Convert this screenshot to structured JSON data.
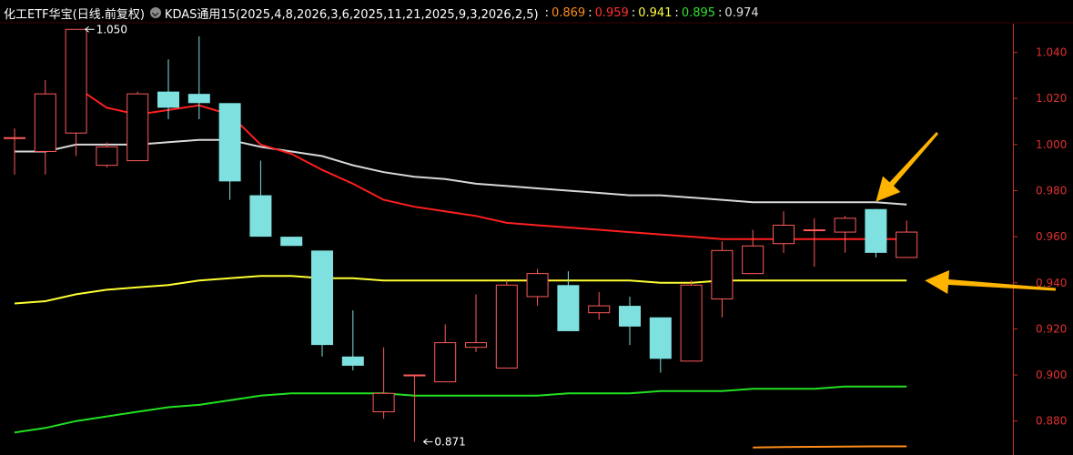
{
  "header": {
    "title": "化工ETF华宝(日线.前复权)",
    "indicator": "KDAS通用15(2025,4,8,2026,3,6,2025,11,21,2025,9,3,2026,2,5)",
    "values": [
      {
        "text": "0.869",
        "color": "#ff8c1a"
      },
      {
        "text": "0.959",
        "color": "#ff3030"
      },
      {
        "text": "0.941",
        "color": "#ffff40"
      },
      {
        "text": "0.895",
        "color": "#30e030"
      },
      {
        "text": "0.974",
        "color": "#e0e0e0"
      }
    ]
  },
  "chart_data": {
    "type": "candlestick",
    "y_ticks": [
      "0.880",
      "0.900",
      "0.920",
      "0.940",
      "0.960",
      "0.980",
      "1.000",
      "1.020",
      "1.040"
    ],
    "ylim": [
      0.8692,
      1.0509
    ],
    "up_color": "#ff5a5a",
    "down_color": "#7fe0e0",
    "candles": [
      {
        "o": 1.003,
        "h": 1.007,
        "l": 0.987,
        "c": 1.003
      },
      {
        "o": 0.997,
        "h": 1.028,
        "l": 0.987,
        "c": 1.022
      },
      {
        "o": 1.005,
        "h": 1.05,
        "l": 0.995,
        "c": 1.05
      },
      {
        "o": 0.991,
        "h": 1.001,
        "l": 0.99,
        "c": 0.999
      },
      {
        "o": 0.993,
        "h": 1.023,
        "l": 0.993,
        "c": 1.022
      },
      {
        "o": 1.023,
        "h": 1.037,
        "l": 1.011,
        "c": 1.016
      },
      {
        "o": 1.022,
        "h": 1.047,
        "l": 1.011,
        "c": 1.018
      },
      {
        "o": 1.018,
        "h": 1.018,
        "l": 0.976,
        "c": 0.984
      },
      {
        "o": 0.978,
        "h": 0.993,
        "l": 0.96,
        "c": 0.96
      },
      {
        "o": 0.96,
        "h": 0.96,
        "l": 0.956,
        "c": 0.956
      },
      {
        "o": 0.954,
        "h": 0.954,
        "l": 0.908,
        "c": 0.913
      },
      {
        "o": 0.908,
        "h": 0.928,
        "l": 0.902,
        "c": 0.904
      },
      {
        "o": 0.884,
        "h": 0.912,
        "l": 0.881,
        "c": 0.892
      },
      {
        "o": 0.9,
        "h": 0.9,
        "l": 0.871,
        "c": 0.9
      },
      {
        "o": 0.897,
        "h": 0.922,
        "l": 0.897,
        "c": 0.914
      },
      {
        "o": 0.912,
        "h": 0.935,
        "l": 0.91,
        "c": 0.914
      },
      {
        "o": 0.903,
        "h": 0.941,
        "l": 0.903,
        "c": 0.939
      },
      {
        "o": 0.934,
        "h": 0.946,
        "l": 0.93,
        "c": 0.944
      },
      {
        "o": 0.939,
        "h": 0.945,
        "l": 0.919,
        "c": 0.919
      },
      {
        "o": 0.927,
        "h": 0.936,
        "l": 0.924,
        "c": 0.93
      },
      {
        "o": 0.93,
        "h": 0.934,
        "l": 0.913,
        "c": 0.921
      },
      {
        "o": 0.925,
        "h": 0.925,
        "l": 0.901,
        "c": 0.907
      },
      {
        "o": 0.906,
        "h": 0.941,
        "l": 0.906,
        "c": 0.939
      },
      {
        "o": 0.933,
        "h": 0.958,
        "l": 0.925,
        "c": 0.954
      },
      {
        "o": 0.944,
        "h": 0.963,
        "l": 0.944,
        "c": 0.956
      },
      {
        "o": 0.957,
        "h": 0.971,
        "l": 0.953,
        "c": 0.965
      },
      {
        "o": 0.963,
        "h": 0.968,
        "l": 0.947,
        "c": 0.963
      },
      {
        "o": 0.962,
        "h": 0.969,
        "l": 0.953,
        "c": 0.968
      },
      {
        "o": 0.972,
        "h": 0.972,
        "l": 0.951,
        "c": 0.953
      },
      {
        "o": 0.951,
        "h": 0.967,
        "l": 0.951,
        "c": 0.962
      }
    ],
    "series": [
      {
        "color": "#d8d8d8",
        "points": [
          [
            0,
            0.997
          ],
          [
            1,
            0.997
          ],
          [
            2,
            1.0
          ],
          [
            3,
            1.0
          ],
          [
            4,
            1.0
          ],
          [
            5,
            1.001
          ],
          [
            6,
            1.002
          ],
          [
            7,
            1.002
          ],
          [
            8,
            0.999
          ],
          [
            9,
            0.997
          ],
          [
            10,
            0.995
          ],
          [
            11,
            0.991
          ],
          [
            12,
            0.988
          ],
          [
            13,
            0.986
          ],
          [
            14,
            0.985
          ],
          [
            15,
            0.983
          ],
          [
            16,
            0.982
          ],
          [
            17,
            0.981
          ],
          [
            18,
            0.98
          ],
          [
            19,
            0.979
          ],
          [
            20,
            0.978
          ],
          [
            21,
            0.978
          ],
          [
            22,
            0.977
          ],
          [
            23,
            0.976
          ],
          [
            24,
            0.975
          ],
          [
            25,
            0.975
          ],
          [
            26,
            0.975
          ],
          [
            27,
            0.975
          ],
          [
            28,
            0.975
          ],
          [
            29,
            0.974
          ]
        ]
      },
      {
        "color": "#ff1f1f",
        "points": [
          [
            2,
            1.025
          ],
          [
            3,
            1.016
          ],
          [
            4,
            1.013
          ],
          [
            5,
            1.015
          ],
          [
            6,
            1.017
          ],
          [
            7,
            1.013
          ],
          [
            8,
            1.0
          ],
          [
            9,
            0.996
          ],
          [
            10,
            0.989
          ],
          [
            11,
            0.983
          ],
          [
            12,
            0.976
          ],
          [
            13,
            0.973
          ],
          [
            14,
            0.971
          ],
          [
            15,
            0.969
          ],
          [
            16,
            0.966
          ],
          [
            17,
            0.965
          ],
          [
            18,
            0.964
          ],
          [
            19,
            0.963
          ],
          [
            20,
            0.962
          ],
          [
            21,
            0.961
          ],
          [
            22,
            0.96
          ],
          [
            23,
            0.959
          ],
          [
            24,
            0.959
          ],
          [
            25,
            0.959
          ],
          [
            26,
            0.959
          ],
          [
            27,
            0.959
          ],
          [
            28,
            0.959
          ],
          [
            29,
            0.959
          ]
        ]
      },
      {
        "color": "#ffff33",
        "points": [
          [
            0,
            0.931
          ],
          [
            1,
            0.932
          ],
          [
            2,
            0.935
          ],
          [
            3,
            0.937
          ],
          [
            4,
            0.938
          ],
          [
            5,
            0.939
          ],
          [
            6,
            0.941
          ],
          [
            7,
            0.942
          ],
          [
            8,
            0.943
          ],
          [
            9,
            0.943
          ],
          [
            10,
            0.942
          ],
          [
            11,
            0.942
          ],
          [
            12,
            0.941
          ],
          [
            13,
            0.941
          ],
          [
            14,
            0.941
          ],
          [
            15,
            0.941
          ],
          [
            16,
            0.941
          ],
          [
            17,
            0.941
          ],
          [
            18,
            0.941
          ],
          [
            19,
            0.941
          ],
          [
            20,
            0.941
          ],
          [
            21,
            0.94
          ],
          [
            22,
            0.94
          ],
          [
            23,
            0.941
          ],
          [
            24,
            0.941
          ],
          [
            25,
            0.941
          ],
          [
            26,
            0.941
          ],
          [
            27,
            0.941
          ],
          [
            28,
            0.941
          ],
          [
            29,
            0.941
          ]
        ]
      },
      {
        "color": "#22e022",
        "points": [
          [
            0,
            0.875
          ],
          [
            1,
            0.877
          ],
          [
            2,
            0.88
          ],
          [
            3,
            0.882
          ],
          [
            4,
            0.884
          ],
          [
            5,
            0.886
          ],
          [
            6,
            0.887
          ],
          [
            7,
            0.889
          ],
          [
            8,
            0.891
          ],
          [
            9,
            0.892
          ],
          [
            10,
            0.892
          ],
          [
            11,
            0.892
          ],
          [
            12,
            0.892
          ],
          [
            13,
            0.891
          ],
          [
            14,
            0.891
          ],
          [
            15,
            0.891
          ],
          [
            16,
            0.891
          ],
          [
            17,
            0.891
          ],
          [
            18,
            0.892
          ],
          [
            19,
            0.892
          ],
          [
            20,
            0.892
          ],
          [
            21,
            0.893
          ],
          [
            22,
            0.893
          ],
          [
            23,
            0.893
          ],
          [
            24,
            0.894
          ],
          [
            25,
            0.894
          ],
          [
            26,
            0.894
          ],
          [
            27,
            0.895
          ],
          [
            28,
            0.895
          ],
          [
            29,
            0.895
          ]
        ]
      },
      {
        "color": "#ff8c1a",
        "points": [
          [
            24,
            0.8685
          ],
          [
            25,
            0.8687
          ],
          [
            26,
            0.8688
          ],
          [
            27,
            0.8689
          ],
          [
            28,
            0.869
          ],
          [
            29,
            0.869
          ]
        ]
      }
    ],
    "annotations": [
      {
        "text": "1.050",
        "index": 2,
        "value": 1.05,
        "side": "right"
      },
      {
        "text": "0.871",
        "index": 13,
        "value": 0.871,
        "side": "right"
      }
    ],
    "arrows": [
      {
        "target_index": 28,
        "target_value": 0.974
      },
      {
        "target_index": 29,
        "target_value": 0.941
      }
    ]
  }
}
